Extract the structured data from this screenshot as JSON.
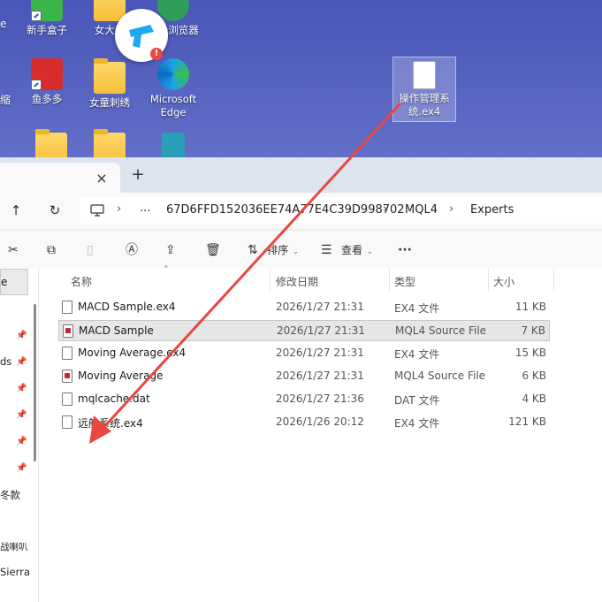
{
  "desktop": {
    "icons": [
      {
        "label": "新手盒子"
      },
      {
        "label": "女大厂"
      },
      {
        "label": "安全浏览器"
      },
      {
        "label": "鱼多多"
      },
      {
        "label": "女童刺绣"
      },
      {
        "label": "Microsoft Edge"
      },
      {
        "label": "操作管理系统.ex4"
      }
    ],
    "edge_left_label": "e",
    "edge_left_label2": "缩"
  },
  "explorer": {
    "tab_close": "×",
    "new_tab": "+",
    "nav": {
      "up": "↑",
      "refresh": "↻",
      "more": "..."
    },
    "breadcrumb": [
      "67D6FFD152036EE74A77E4C39D998702",
      "MQL4",
      "Experts"
    ],
    "crumb_sep": "›",
    "toolbar": {
      "sort_label": "排序",
      "view_label": "查看",
      "more": "···"
    },
    "navpane": {
      "selected": "e",
      "items": [
        "ds",
        "冬款",
        "战喇叭",
        "Sierra"
      ]
    },
    "columns": {
      "name": "名称",
      "date": "修改日期",
      "type": "类型",
      "size": "大小"
    },
    "files": [
      {
        "name": "MACD Sample.ex4",
        "date": "2026/1/27 21:31",
        "type": "EX4 文件",
        "size": "11 KB",
        "icon": "file"
      },
      {
        "name": "MACD Sample",
        "date": "2026/1/27 21:31",
        "type": "MQL4 Source File",
        "size": "7 KB",
        "icon": "src"
      },
      {
        "name": "Moving Average.ex4",
        "date": "2026/1/27 21:31",
        "type": "EX4 文件",
        "size": "15 KB",
        "icon": "file"
      },
      {
        "name": "Moving Average",
        "date": "2026/1/27 21:31",
        "type": "MQL4 Source File",
        "size": "6 KB",
        "icon": "src"
      },
      {
        "name": "mqlcache.dat",
        "date": "2026/1/27 21:36",
        "type": "DAT 文件",
        "size": "4 KB",
        "icon": "file"
      },
      {
        "name": "远航系统.ex4",
        "date": "2026/1/26 20:12",
        "type": "EX4 文件",
        "size": "121 KB",
        "icon": "file"
      }
    ]
  },
  "colors": {
    "arrow": "#e8483f",
    "accent": "#1e63d8"
  }
}
